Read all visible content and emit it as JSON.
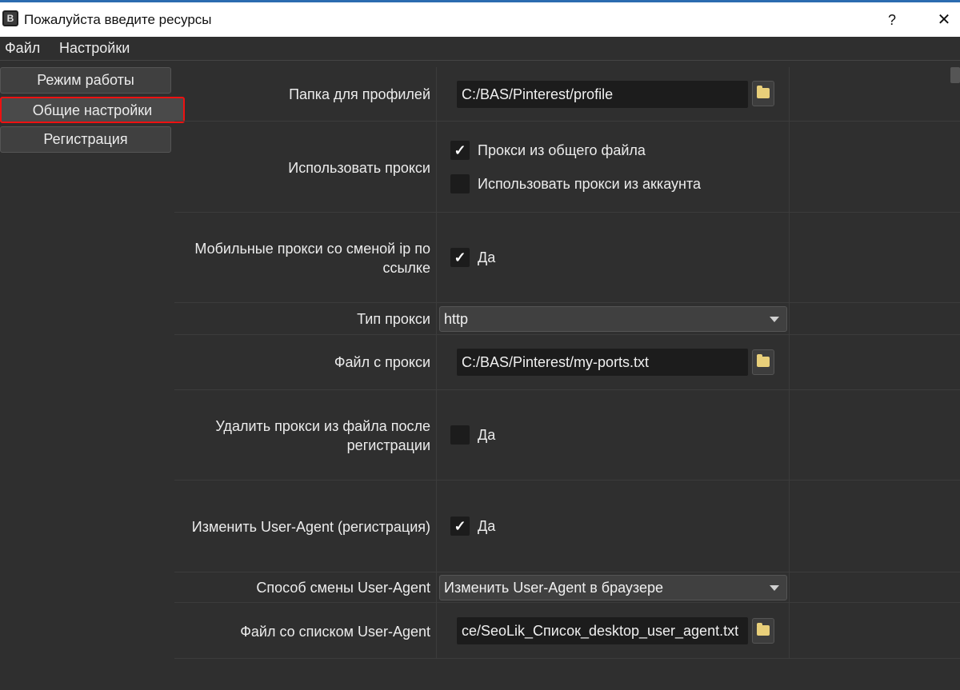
{
  "window": {
    "title": "Пожалуйста введите ресурсы",
    "help_label": "?",
    "close_label": "✕",
    "icon_glyph": "B"
  },
  "menu": [
    "Файл",
    "Настройки"
  ],
  "nav": [
    {
      "label": "Режим работы",
      "active": false
    },
    {
      "label": "Общие настройки",
      "active": true
    },
    {
      "label": "Регистрация",
      "active": false
    }
  ],
  "settings": {
    "profiles_folder": {
      "label": "Папка для профилей",
      "value": "C:/BAS/Pinterest/profile"
    },
    "use_proxy": {
      "label": "Использовать прокси",
      "options": [
        {
          "label": "Прокси из общего файла",
          "checked": true
        },
        {
          "label": "Использовать прокси из аккаунта",
          "checked": false
        }
      ]
    },
    "mobile_proxy": {
      "label": "Мобильные прокси со сменой ip по ссылке",
      "option": "Да",
      "checked": true
    },
    "proxy_type": {
      "label": "Тип прокси",
      "value": "http"
    },
    "proxy_file": {
      "label": "Файл с прокси",
      "value": "C:/BAS/Pinterest/my-ports.txt"
    },
    "delete_proxy": {
      "label": "Удалить прокси из файла после регистрации",
      "option": "Да",
      "checked": false
    },
    "change_ua": {
      "label": "Изменить User-Agent (регистрация)",
      "option": "Да",
      "checked": true
    },
    "ua_method": {
      "label": "Способ смены User-Agent",
      "value": "Изменить User-Agent в браузере"
    },
    "ua_file": {
      "label": "Файл со списком User-Agent",
      "value": "ce/SeoLik_Список_desktop_user_agent.txt"
    }
  },
  "check_glyph": "✓",
  "icons": {
    "folder": "folder-icon",
    "dropdown": "chevron-down-icon"
  },
  "colors": {
    "background": "#2f2f2f",
    "input_bg": "#1c1c1c",
    "highlight": "#ee1111",
    "folder": "#e8cf7a"
  }
}
